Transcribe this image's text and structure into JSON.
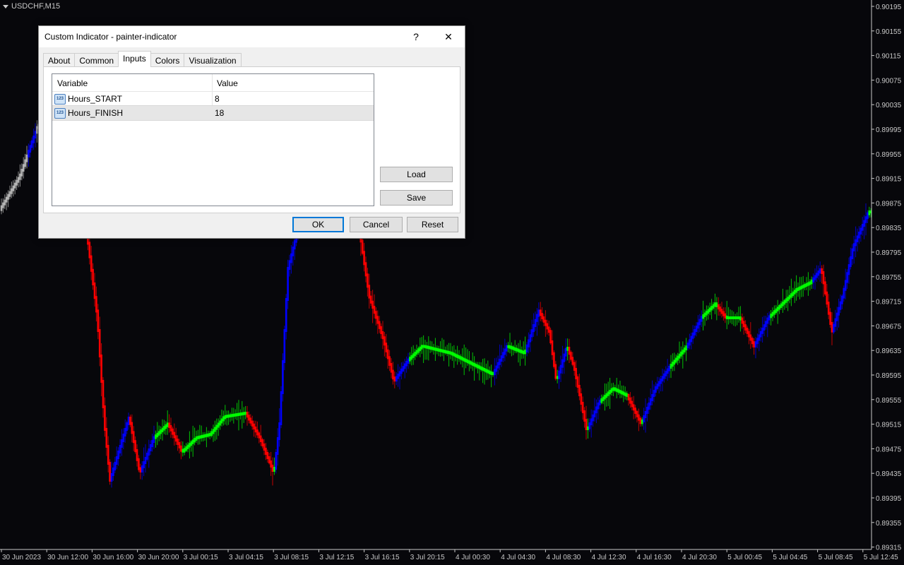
{
  "chart": {
    "symbol": "USDCHF,M15",
    "price_ticks": [
      "0.90195",
      "0.90155",
      "0.90115",
      "0.90075",
      "0.90035",
      "0.89995",
      "0.89955",
      "0.89915",
      "0.89875",
      "0.89835",
      "0.89795",
      "0.89755",
      "0.89715",
      "0.89675",
      "0.89635",
      "0.89595",
      "0.89555",
      "0.89515",
      "0.89475",
      "0.89435",
      "0.89395",
      "0.89355",
      "0.89315"
    ],
    "time_ticks": [
      "30 Jun 2023",
      "30 Jun 12:00",
      "30 Jun 16:00",
      "30 Jun 20:00",
      "3 Jul 00:15",
      "3 Jul 04:15",
      "3 Jul 08:15",
      "3 Jul 12:15",
      "3 Jul 16:15",
      "3 Jul 20:15",
      "4 Jul 00:30",
      "4 Jul 04:30",
      "4 Jul 08:30",
      "4 Jul 12:30",
      "4 Jul 16:30",
      "4 Jul 20:30",
      "5 Jul 00:45",
      "5 Jul 04:45",
      "5 Jul 08:45",
      "5 Jul 12:45"
    ],
    "colors": {
      "background": "#07070b",
      "up": "#00ff00",
      "down": "#ff0000",
      "neutral": "#0000ff",
      "outside": "#b4b4b4",
      "axis_text": "#c8c8c8"
    }
  },
  "dialog": {
    "title": "Custom Indicator - painter-indicator",
    "help_label": "?",
    "close_label": "✕",
    "tabs": [
      "About",
      "Common",
      "Inputs",
      "Colors",
      "Visualization"
    ],
    "active_tab": "Inputs",
    "grid": {
      "headers": {
        "variable": "Variable",
        "value": "Value"
      },
      "rows": [
        {
          "icon": "123",
          "variable": "Hours_START",
          "value": "8"
        },
        {
          "icon": "123",
          "variable": "Hours_FINISH",
          "value": "18"
        }
      ]
    },
    "buttons": {
      "load": "Load",
      "save": "Save",
      "ok": "OK",
      "cancel": "Cancel",
      "reset": "Reset"
    }
  }
}
